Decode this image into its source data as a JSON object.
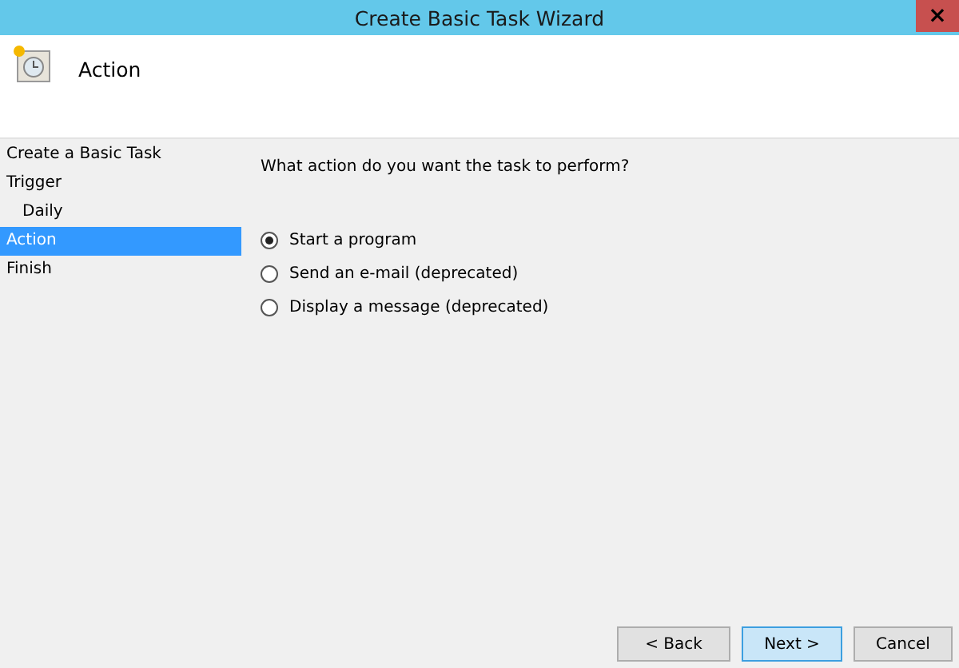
{
  "window": {
    "title": "Create Basic Task Wizard",
    "close": "×"
  },
  "header": {
    "title": "Action"
  },
  "steps": [
    {
      "label": "Create a Basic Task",
      "selected": false
    },
    {
      "label": "Trigger",
      "selected": false,
      "children": [
        {
          "label": "Daily",
          "selected": false
        }
      ]
    },
    {
      "label": "Action",
      "selected": true
    },
    {
      "label": "Finish",
      "selected": false
    }
  ],
  "question": "What action do you want the task to perform?",
  "options": [
    {
      "label": "Start a program",
      "selected": true
    },
    {
      "label": "Send an e-mail (deprecated)",
      "selected": false
    },
    {
      "label": "Display a message (deprecated)",
      "selected": false
    }
  ],
  "buttons": [
    {
      "label": "< Back",
      "kind": "normal"
    },
    {
      "label": "Next >",
      "kind": "default"
    },
    {
      "label": "Cancel",
      "kind": "normal"
    }
  ]
}
